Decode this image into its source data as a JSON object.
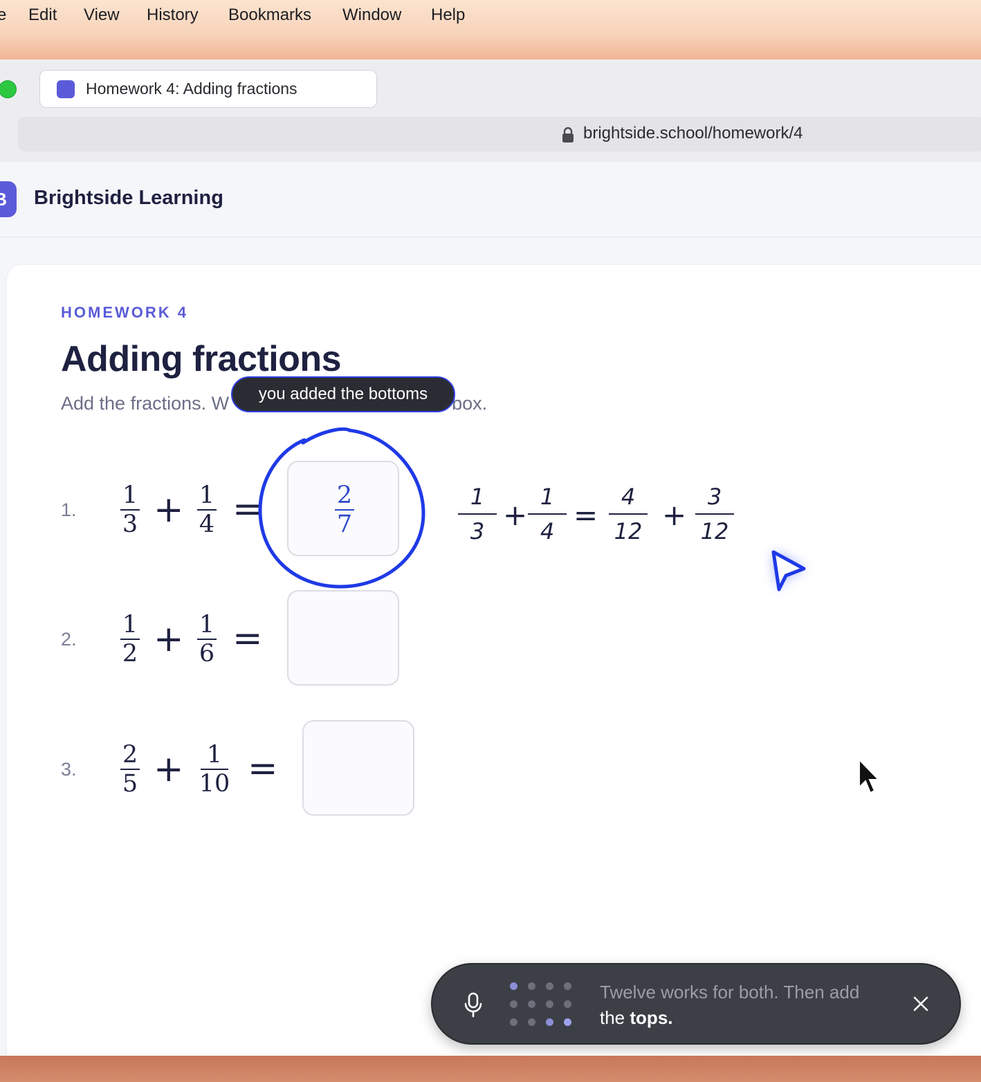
{
  "menubar": {
    "items": [
      "e",
      "Edit",
      "View",
      "History",
      "Bookmarks",
      "Window",
      "Help"
    ]
  },
  "browser": {
    "tab_title": "Homework 4: Adding fractions",
    "url": "brightside.school/homework/4"
  },
  "site": {
    "logo_letter": "B",
    "name": "Brightside Learning"
  },
  "homework": {
    "eyebrow": "HOMEWORK 4",
    "title": "Adding fractions",
    "instructions": "Add the fractions. Write your answer in the box.",
    "instructions_visible_start": "Add the fractions. W",
    "instructions_visible_end": "box.",
    "questions": [
      {
        "number": "1.",
        "a_num": "1",
        "a_den": "3",
        "b_num": "1",
        "b_den": "4",
        "plus": "+",
        "equals": "=",
        "answer_num": "2",
        "answer_den": "7"
      },
      {
        "number": "2.",
        "a_num": "1",
        "a_den": "2",
        "b_num": "1",
        "b_den": "6",
        "plus": "+",
        "equals": "="
      },
      {
        "number": "3.",
        "a_num": "2",
        "a_den": "5",
        "b_num": "1",
        "b_den": "10",
        "plus": "+",
        "equals": "="
      }
    ]
  },
  "annotation": {
    "tooltip": "you added the bottoms",
    "handwritten": {
      "f1_num": "1",
      "f1_den": "3",
      "plus1": "+",
      "f2_num": "1",
      "f2_den": "4",
      "equals": "=",
      "f3_num": "4",
      "f3_den": "12",
      "plus2": "+",
      "f4_num": "3",
      "f4_den": "12"
    },
    "circle_color": "#1f3ae6"
  },
  "voice": {
    "text_muted": "Twelve works for both. Then add",
    "text_prefix": "the",
    "text_highlight": "tops."
  },
  "colors": {
    "brand": "#5b5bd9",
    "ink": "#1e2140",
    "accent_blue": "#1f3ae6"
  }
}
